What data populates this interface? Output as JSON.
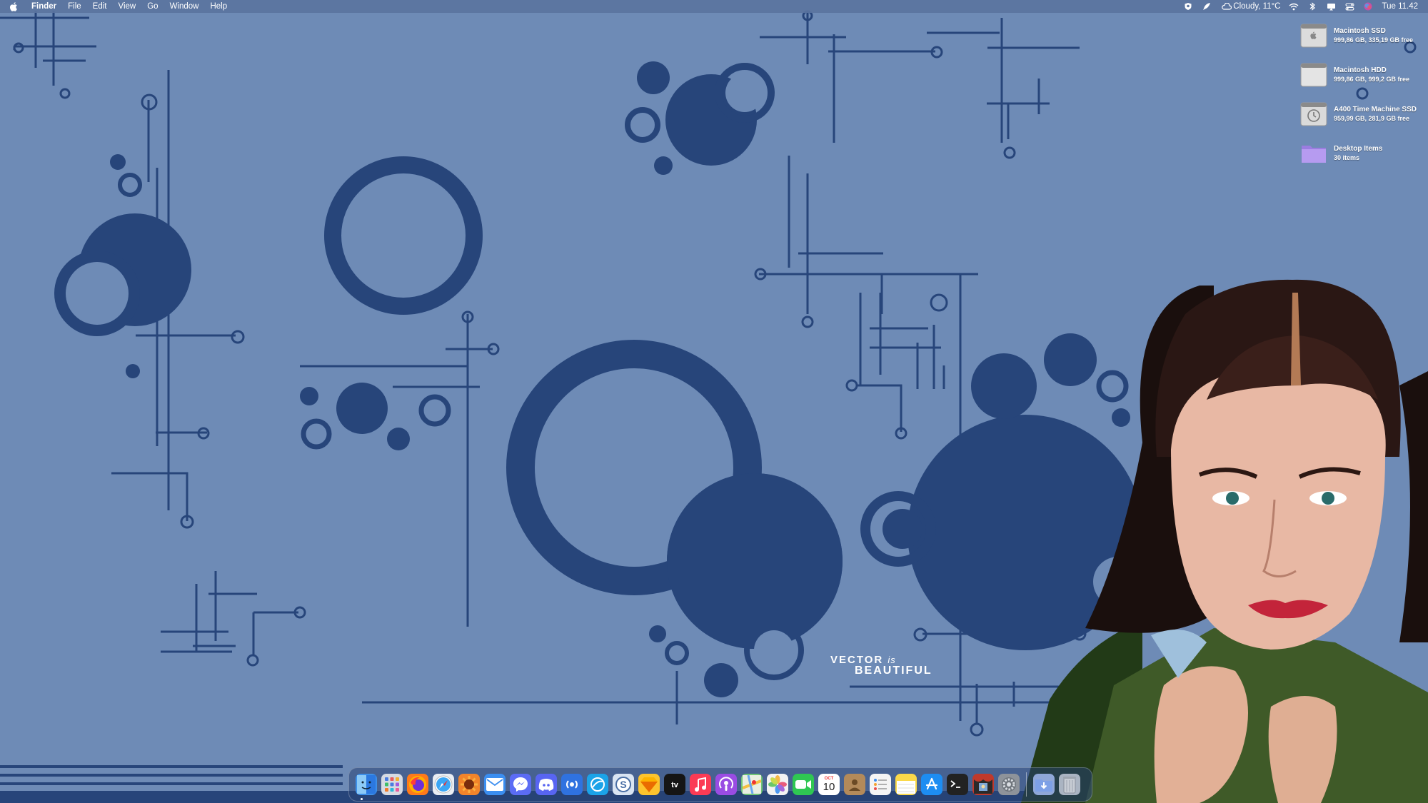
{
  "menubar": {
    "apple_icon": "apple-logo-icon",
    "app_name": "Finder",
    "menus": [
      "File",
      "Edit",
      "View",
      "Go",
      "Window",
      "Help"
    ],
    "status_icons": [
      "shield-icon",
      "feather-icon"
    ],
    "weather": "Cloudy, 11°C",
    "status_icons_2": [
      "wifi-icon",
      "bluetooth-icon",
      "cast-icon",
      "control-center-icon",
      "siri-icon"
    ],
    "clock": "Tue 11.42"
  },
  "desktop": {
    "items": [
      {
        "name": "Macintosh SSD",
        "detail": "999,86 GB, 335,19 GB free",
        "icon": "internal-disk-icon"
      },
      {
        "name": "Macintosh HDD",
        "detail": "999,86 GB, 999,2 GB free",
        "icon": "internal-disk-icon"
      },
      {
        "name": "A400 Time Machine SSD",
        "detail": "959,99 GB, 281,9 GB free",
        "icon": "time-machine-disk-icon"
      },
      {
        "name": "Desktop Items",
        "detail": "30 items",
        "icon": "folder-icon"
      }
    ]
  },
  "wallpaper": {
    "caption_line1_a": "VECTOR",
    "caption_line1_b": "is",
    "caption_line2": "BEAUTIFUL"
  },
  "dock": {
    "apps": [
      {
        "name": "Finder",
        "icon": "finder-icon",
        "color": "#3d8fe8"
      },
      {
        "name": "Launchpad",
        "icon": "launchpad-icon",
        "color": "#d6dbe3"
      },
      {
        "name": "Firefox",
        "icon": "firefox-icon",
        "color": "#ff7a1a"
      },
      {
        "name": "Safari",
        "icon": "safari-icon",
        "color": "#e9edf3"
      },
      {
        "name": "Fusion",
        "icon": "sunburst-icon",
        "color": "#f2842a"
      },
      {
        "name": "Mail",
        "icon": "mail-icon",
        "color": "#3b8ef0"
      },
      {
        "name": "Messenger",
        "icon": "messenger-icon",
        "color": "#5b6cf5"
      },
      {
        "name": "Discord",
        "icon": "discord-icon",
        "color": "#5865f2"
      },
      {
        "name": "Podcast Radio",
        "icon": "radio-icon",
        "color": "#2f72e0"
      },
      {
        "name": "Browser",
        "icon": "globe-icon",
        "color": "#1ba3e8"
      },
      {
        "name": "Skype",
        "icon": "skype-icon",
        "color": "#d9e4f2"
      },
      {
        "name": "Sketch",
        "icon": "sketch-icon",
        "color": "#fdc42d"
      },
      {
        "name": "TV",
        "icon": "apple-tv-icon",
        "color": "#151515"
      },
      {
        "name": "Music",
        "icon": "music-icon",
        "color": "#fb3b55"
      },
      {
        "name": "Podcasts",
        "icon": "podcasts-icon",
        "color": "#9a4ce3"
      },
      {
        "name": "Maps",
        "icon": "maps-icon",
        "color": "#6fc576"
      },
      {
        "name": "Photos",
        "icon": "photos-icon",
        "color": "#f3f3f3"
      },
      {
        "name": "FaceTime",
        "icon": "facetime-icon",
        "color": "#2fc752"
      },
      {
        "name": "Calendar",
        "icon": "calendar-icon",
        "color": "#ffffff",
        "month": "OCT",
        "day": "10"
      },
      {
        "name": "Contacts",
        "icon": "contacts-icon",
        "color": "#b38a5a"
      },
      {
        "name": "Reminders",
        "icon": "reminders-icon",
        "color": "#f4f4f4"
      },
      {
        "name": "Notes",
        "icon": "notes-icon",
        "color": "#fbd94a"
      },
      {
        "name": "App Store",
        "icon": "app-store-icon",
        "color": "#1d8df2"
      },
      {
        "name": "Terminal",
        "icon": "terminal-icon",
        "color": "#222222"
      },
      {
        "name": "Photo Booth",
        "icon": "photo-booth-icon",
        "color": "#c0392b"
      },
      {
        "name": "System Preferences",
        "icon": "gear-icon",
        "color": "#8e939a"
      }
    ],
    "trailing": [
      {
        "name": "Downloads",
        "icon": "downloads-folder-icon",
        "color": "#8fa7d8"
      },
      {
        "name": "Trash",
        "icon": "trash-icon",
        "color": "#aab4c2"
      }
    ]
  }
}
